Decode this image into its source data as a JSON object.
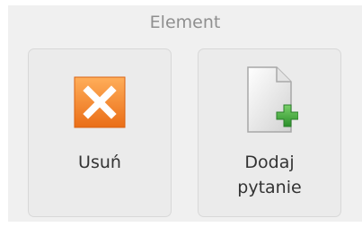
{
  "group": {
    "title": "Element"
  },
  "buttons": [
    {
      "label": "Usuń",
      "icon": "delete-x-icon",
      "color": "#f0822a"
    },
    {
      "label_line1": "Dodaj",
      "label_line2": "pytanie",
      "icon": "add-document-icon",
      "color": "#3aa43a"
    }
  ]
}
